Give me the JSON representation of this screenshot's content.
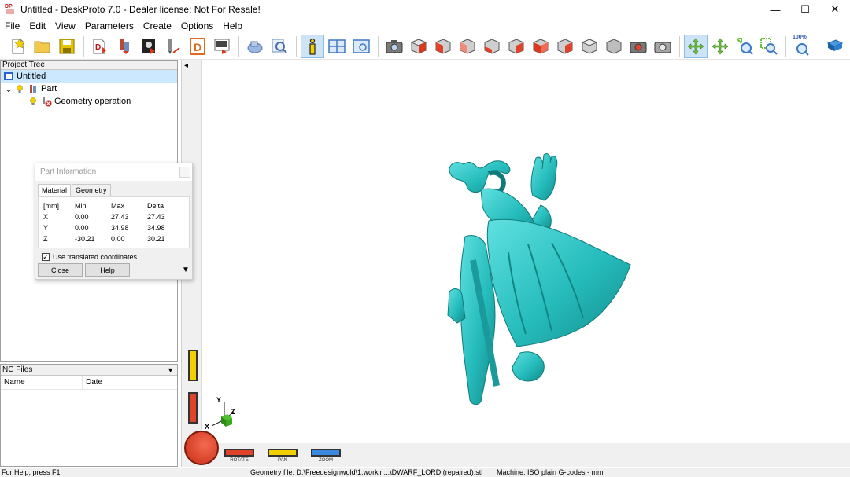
{
  "window": {
    "title": "Untitled - DeskProto 7.0 - Dealer license: Not For Resale!",
    "logo_text": "DP",
    "minimize": "—",
    "maximize": "☐",
    "close": "✕"
  },
  "menu": [
    "File",
    "Edit",
    "View",
    "Parameters",
    "Create",
    "Options",
    "Help"
  ],
  "toolbar": {
    "zoom_label": "100%"
  },
  "project_tree": {
    "header": "Project Tree",
    "items": [
      {
        "label": "Untitled"
      },
      {
        "label": "Part"
      },
      {
        "label": "Geometry operation"
      }
    ],
    "expander": "⌄"
  },
  "nc_files": {
    "header": "NC Files",
    "dropdown": "▼",
    "columns": [
      "Name",
      "Date"
    ]
  },
  "part_info": {
    "title": "Part Information",
    "tabs": [
      "Material",
      "Geometry"
    ],
    "headers": [
      "[mm]",
      "Min",
      "Max",
      "Delta"
    ],
    "rows": [
      [
        "X",
        "0.00",
        "27.43",
        "27.43"
      ],
      [
        "Y",
        "0.00",
        "34.98",
        "34.98"
      ],
      [
        "Z",
        "-30.21",
        "0.00",
        "30.21"
      ]
    ],
    "use_translated_label": "Use translated coordinates",
    "use_translated_checked": true,
    "check_mark": "✓",
    "close_label": "Close",
    "help_label": "Help",
    "expand_arrow": "▼"
  },
  "viewport": {
    "collapse_arrow": "◂",
    "axis_labels": {
      "x": "X",
      "y": "Y",
      "z": "Z"
    },
    "nav_labels": {
      "rotate": "ROTATE",
      "pan": "PAN",
      "zoom": "ZOOM"
    },
    "model_color": "#2fc4c4"
  },
  "status": {
    "help": "For Help, press F1",
    "geometry_file": "Geometry file: D:\\Freedesignwold\\1.workin...\\DWARF_LORD (repaired).stl",
    "machine": "Machine: ISO plain G-codes - mm"
  }
}
